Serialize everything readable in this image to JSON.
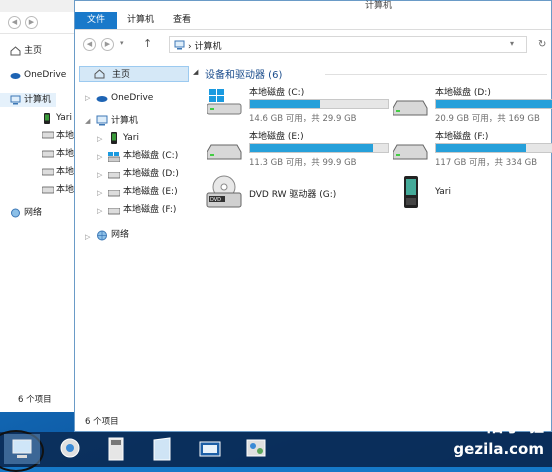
{
  "back_window": {
    "nav_items": [
      {
        "label": "主页",
        "icon": "home-icon"
      },
      {
        "label": "OneDrive",
        "icon": "onedrive-icon"
      },
      {
        "label": "计算机",
        "icon": "computer-icon"
      },
      {
        "label": "Yari",
        "icon": "phone-icon"
      },
      {
        "label": "本地",
        "icon": "drive-icon"
      },
      {
        "label": "本地",
        "icon": "drive-icon"
      },
      {
        "label": "本地",
        "icon": "drive-icon"
      },
      {
        "label": "本地",
        "icon": "drive-icon"
      },
      {
        "label": "网络",
        "icon": "network-icon"
      }
    ],
    "status": "6 个项目"
  },
  "window": {
    "title": "计算机",
    "tabs": [
      "文件",
      "计算机",
      "查看"
    ],
    "address": "计算机",
    "nav": {
      "home": "主页",
      "onedrive": "OneDrive",
      "computer": "计算机",
      "children": [
        "Yari",
        "本地磁盘 (C:)",
        "本地磁盘 (D:)",
        "本地磁盘 (E:)",
        "本地磁盘 (F:)"
      ],
      "network": "网络"
    },
    "group_header": "设备和驱动器 (6)",
    "drives": [
      {
        "name": "本地磁盘 (C:)",
        "info": "14.6 GB 可用，共 29.9 GB",
        "used_fraction": 0.51,
        "icon": "windows-drive-icon"
      },
      {
        "name": "本地磁盘 (D:)",
        "info": "20.9 GB 可用，共 169 GB",
        "used_fraction": 0.88,
        "icon": "drive-icon"
      },
      {
        "name": "本地磁盘 (E:)",
        "info": "11.3 GB 可用，共 99.9 GB",
        "used_fraction": 0.89,
        "icon": "drive-icon"
      },
      {
        "name": "本地磁盘 (F:)",
        "info": "117 GB 可用，共 334 GB",
        "used_fraction": 0.65,
        "icon": "drive-icon"
      }
    ],
    "dvd": {
      "name": "DVD RW 驱动器 (G:)",
      "icon": "dvd-drive-icon"
    },
    "device": {
      "name": "Yari",
      "icon": "phone-icon"
    },
    "status": "6 个项目"
  },
  "taskbar": {
    "buttons": [
      "computer-icon",
      "control-panel-icon",
      "calculator-icon",
      "notepad-icon",
      "media-icon",
      "settings-icon"
    ]
  },
  "watermark": {
    "line1": "格子啦",
    "line2": "gezila.com"
  }
}
